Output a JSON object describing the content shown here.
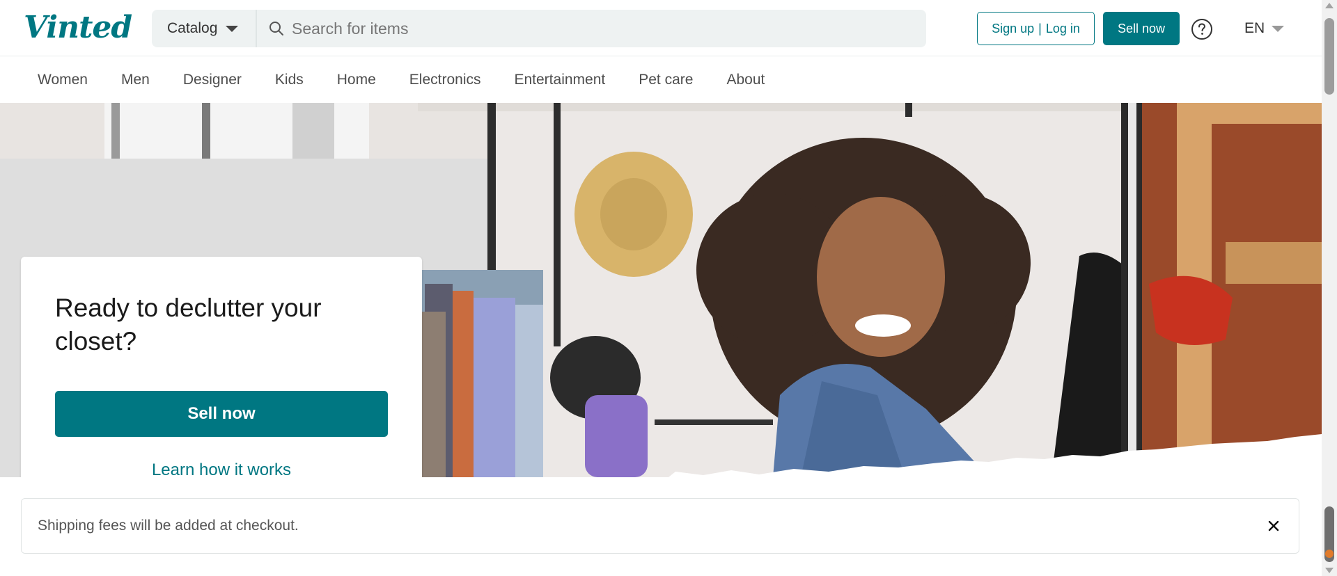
{
  "header": {
    "logo_text": "Vinted",
    "catalog_label": "Catalog",
    "search_placeholder": "Search for items",
    "signup_label": "Sign up",
    "login_label": "Log in",
    "sell_now_label": "Sell now",
    "help_icon": "help-circle-icon",
    "language_label": "EN"
  },
  "nav": {
    "items": [
      {
        "label": "Women"
      },
      {
        "label": "Men"
      },
      {
        "label": "Designer"
      },
      {
        "label": "Kids"
      },
      {
        "label": "Home"
      },
      {
        "label": "Electronics"
      },
      {
        "label": "Entertainment"
      },
      {
        "label": "Pet care"
      },
      {
        "label": "About"
      }
    ]
  },
  "hero": {
    "title": "Ready to declutter your closet?",
    "sell_button_label": "Sell now",
    "learn_link_label": "Learn how it works"
  },
  "banner": {
    "text": "Shipping fees will be added at checkout.",
    "close_icon": "close-icon"
  },
  "colors": {
    "brand": "#007782",
    "search_bg": "#eef2f2"
  }
}
